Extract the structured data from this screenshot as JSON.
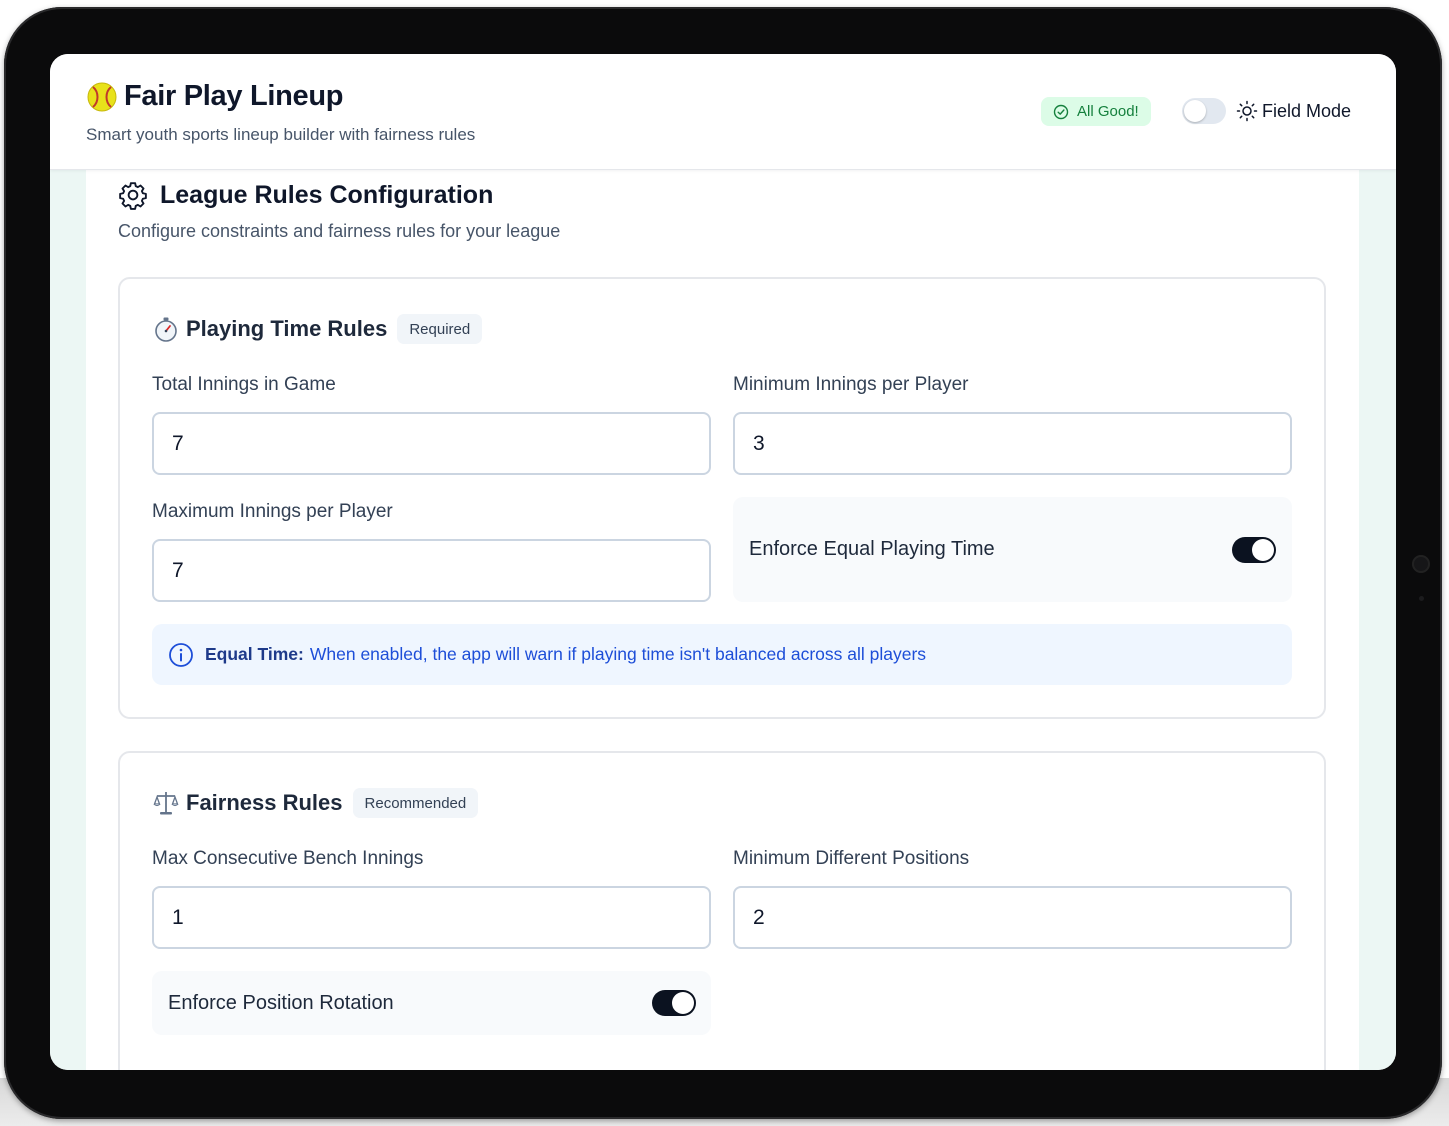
{
  "header": {
    "title": "Fair Play Lineup",
    "subtitle": "Smart youth sports lineup builder with fairness rules",
    "status": "All Good!",
    "field_mode_label": "Field Mode",
    "field_mode_enabled": false
  },
  "config": {
    "title": "League Rules Configuration",
    "description": "Configure constraints and fairness rules for your league"
  },
  "playing_time": {
    "title": "Playing Time Rules",
    "badge": "Required",
    "total_innings_label": "Total Innings in Game",
    "total_innings_value": "7",
    "min_innings_label": "Minimum Innings per Player",
    "min_innings_value": "3",
    "max_innings_label": "Maximum Innings per Player",
    "max_innings_value": "7",
    "equal_time_label": "Enforce Equal Playing Time",
    "equal_time_enabled": true,
    "info_strong": "Equal Time:",
    "info_text": "When enabled, the app will warn if playing time isn't balanced across all players"
  },
  "fairness": {
    "title": "Fairness Rules",
    "badge": "Recommended",
    "max_bench_label": "Max Consecutive Bench Innings",
    "max_bench_value": "1",
    "min_positions_label": "Minimum Different Positions",
    "min_positions_value": "2",
    "rotation_label": "Enforce Position Rotation",
    "rotation_enabled": true
  },
  "colors": {
    "accent_dark": "#0b1220",
    "status_green": "#15803d",
    "info_blue": "#1d4ed8"
  }
}
